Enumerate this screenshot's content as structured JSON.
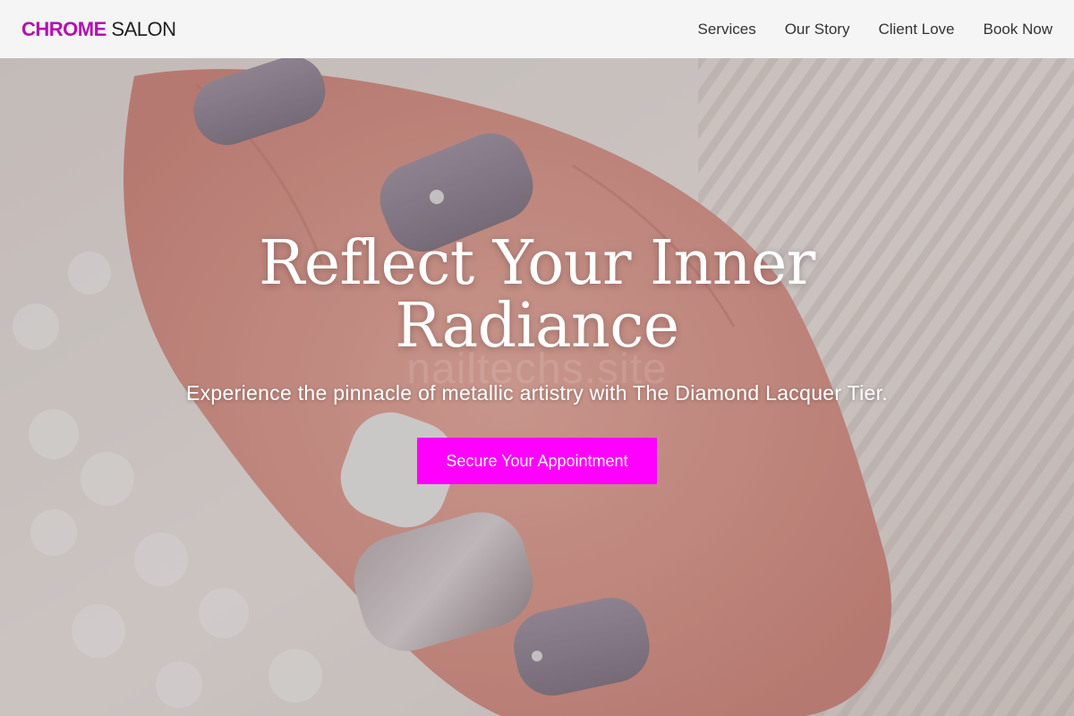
{
  "brand": {
    "accent": "CHROME",
    "rest": " SALON",
    "accent_color": "#b40fb0"
  },
  "nav": {
    "items": [
      {
        "label": "Services"
      },
      {
        "label": "Our Story"
      },
      {
        "label": "Client Love"
      },
      {
        "label": "Book Now"
      }
    ]
  },
  "hero": {
    "title": "Reflect Your Inner Radiance",
    "subtitle": "Experience the pinnacle of metallic artistry with The Diamond Lacquer Tier.",
    "cta_label": "Secure Your Appointment",
    "cta_color": "#ff00ff",
    "watermark": "nailtechs.site",
    "background_image": "hand-with-lavender-and-glitter-nails-on-white-knit"
  }
}
